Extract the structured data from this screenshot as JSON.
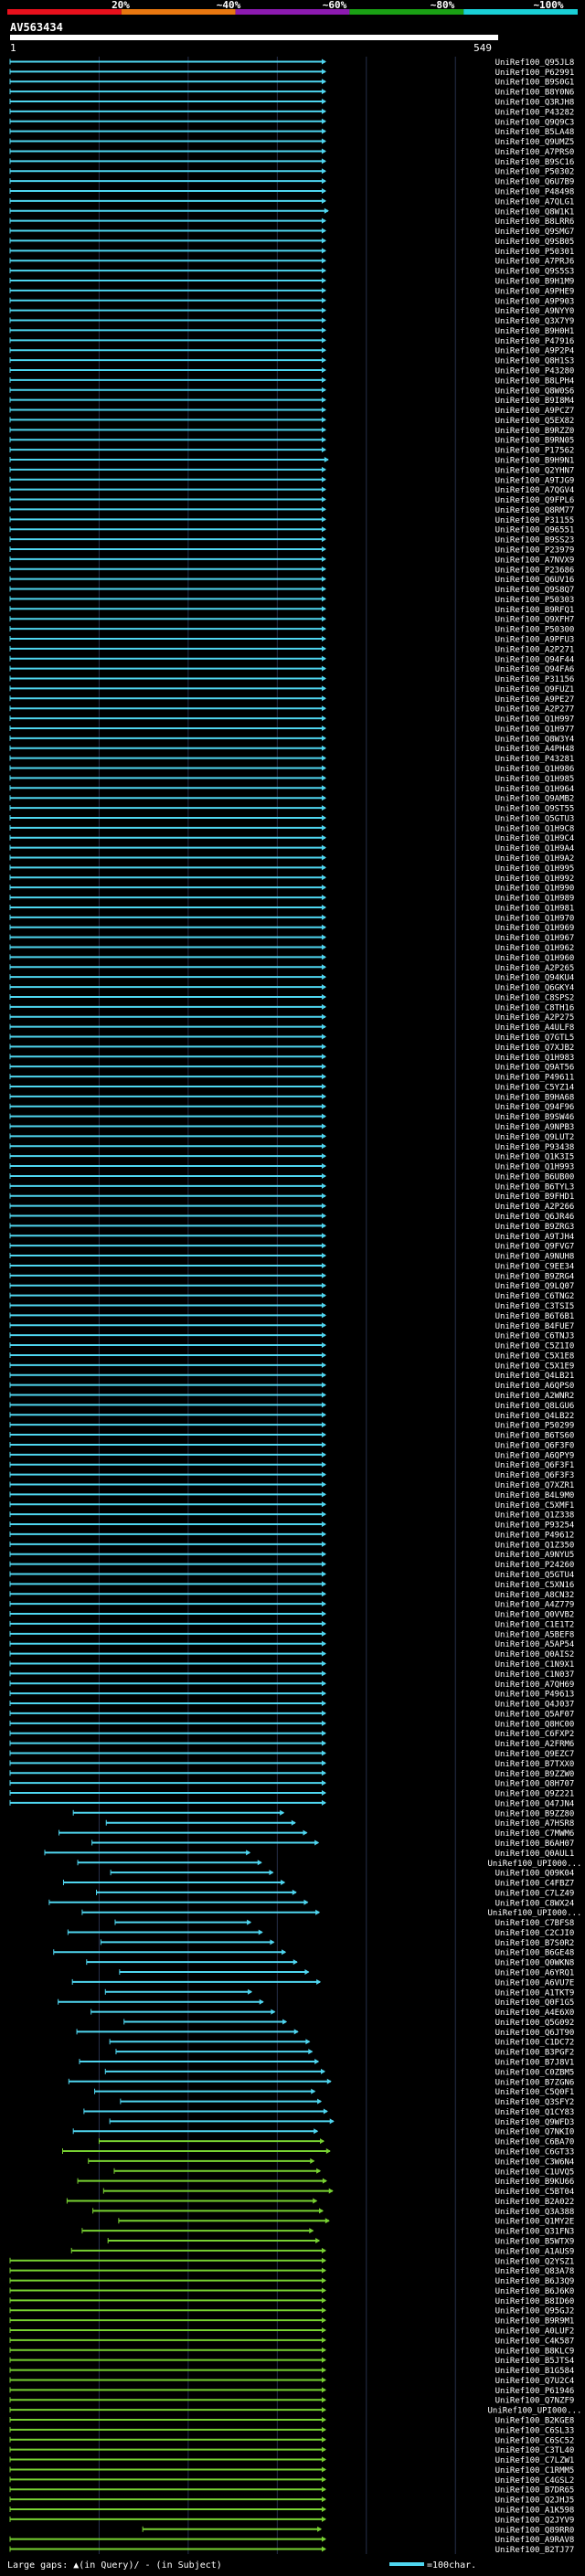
{
  "chart_data": {
    "type": "alignment-map",
    "query_name": "AV563434",
    "query_length": 549,
    "xlim": [
      1,
      549
    ],
    "scale": {
      "ticks": [
        {
          "label": "20%",
          "color": "#e8101c"
        },
        {
          "label": "~40%",
          "color": "#e87710"
        },
        {
          "label": "~60%",
          "color": "#8c1ab0"
        },
        {
          "label": "~80%",
          "color": "#1aa014"
        },
        {
          "label": "~100%",
          "color": "#1ad0d6"
        }
      ]
    },
    "axis": {
      "start_label": "1",
      "end_label": "549"
    },
    "footer": {
      "gaps_text": "Large gaps: ▲(in Query)/ - (in Subject)",
      "legend_text": "=100char."
    },
    "colors": {
      "cyan": "#4fd6f0",
      "green": "#78d232",
      "gap_query": "#ffff30",
      "gap_subject": "#ff0000",
      "grid": "#26304a",
      "bar_stripe_1": "#e8101c",
      "bar_stripe_2": "#e87710",
      "bar_stripe_3": "#8c1ab0",
      "bar_stripe_4": "#1aa014",
      "bar_stripe_5": "#1ad0d6"
    },
    "hits": [
      "UniRef100_Q95JL8",
      "UniRef100_P62991",
      "UniRef100_B9S0G1",
      "UniRef100_B8Y0N6",
      "UniRef100_Q3RJH8",
      "UniRef100_P43282",
      "UniRef100_Q9Q9C3",
      "UniRef100_B5LA48",
      "UniRef100_Q9UMZ5",
      "UniRef100_A7PRS0",
      "UniRef100_B9SC16",
      "UniRef100_P50302",
      "UniRef100_Q6U7B9",
      "UniRef100_P48498",
      "UniRef100_A7QLG1",
      "UniRef100_Q8W1K1",
      "UniRef100_B8LRR6",
      "UniRef100_Q9SMG7",
      "UniRef100_Q9SB05",
      "UniRef100_P50301",
      "UniRef100_A7PRJ6",
      "UniRef100_Q9S5S3",
      "UniRef100_B9H1M9",
      "UniRef100_A9PHE9",
      "UniRef100_A9P903",
      "UniRef100_A9NYY0",
      "UniRef100_Q3X7Y9",
      "UniRef100_B9H0H1",
      "UniRef100_P47916",
      "UniRef100_A9P2P4",
      "UniRef100_Q8H1S3",
      "UniRef100_P43280",
      "UniRef100_B8LPH4",
      "UniRef100_Q8W0S6",
      "UniRef100_B9I8M4",
      "UniRef100_A9PCZ7",
      "UniRef100_Q5EX82",
      "UniRef100_B9RZZ0",
      "UniRef100_B9RN05",
      "UniRef100_P17562",
      "UniRef100_B9H9N1",
      "UniRef100_Q2YHN7",
      "UniRef100_A9TJG9",
      "UniRef100_A7QGV4",
      "UniRef100_Q9FPL6",
      "UniRef100_Q8RM77",
      "UniRef100_P31155",
      "UniRef100_Q96551",
      "UniRef100_B9SS23",
      "UniRef100_P23979",
      "UniRef100_A7NVX9",
      "UniRef100_P23686",
      "UniRef100_Q6UV16",
      "UniRef100_Q9S8Q7",
      "UniRef100_P50303",
      "UniRef100_B9RFQ1",
      "UniRef100_Q9XFH7",
      "UniRef100_P50300",
      "UniRef100_A9PFU3",
      "UniRef100_A2P271",
      "UniRef100_Q94F44",
      "UniRef100_Q94FA6",
      "UniRef100_P31156",
      "UniRef100_Q9FUZ1",
      "UniRef100_A9PE27",
      "UniRef100_A2P277",
      "UniRef100_Q1H997",
      "UniRef100_Q1H977",
      "UniRef100_Q8W3Y4",
      "UniRef100_A4PH48",
      "UniRef100_P43281",
      "UniRef100_Q1H986",
      "UniRef100_Q1H985",
      "UniRef100_Q1H964",
      "UniRef100_Q9AMB2",
      "UniRef100_Q9ST55",
      "UniRef100_Q5GTU3",
      "UniRef100_Q1H9C8",
      "UniRef100_Q1H9C4",
      "UniRef100_Q1H9A4",
      "UniRef100_Q1H9A2",
      "UniRef100_Q1H995",
      "UniRef100_Q1H992",
      "UniRef100_Q1H990",
      "UniRef100_Q1H989",
      "UniRef100_Q1H981",
      "UniRef100_Q1H970",
      "UniRef100_Q1H969",
      "UniRef100_Q1H967",
      "UniRef100_Q1H962",
      "UniRef100_Q1H960",
      "UniRef100_A2P265",
      "UniRef100_Q94KU4",
      "UniRef100_Q6GKY4",
      "UniRef100_C8SPS2",
      "UniRef100_C8TH16",
      "UniRef100_A2P275",
      "UniRef100_A4ULF8",
      "UniRef100_Q7GTL5",
      "UniRef100_Q7XJB2",
      "UniRef100_Q1H983",
      "UniRef100_Q9AT56",
      "UniRef100_P49611",
      "UniRef100_C5YZ14",
      "UniRef100_B9HA68",
      "UniRef100_Q94F96",
      "UniRef100_B9SW46",
      "UniRef100_A9NPB3",
      "UniRef100_Q9LUT2",
      "UniRef100_P93438",
      "UniRef100_Q1K3I5",
      "UniRef100_Q1H993",
      "UniRef100_B6UB00",
      "UniRef100_B6TYL3",
      "UniRef100_B9FHD1",
      "UniRef100_A2P266",
      "UniRef100_Q6JR46",
      "UniRef100_B9ZRG3",
      "UniRef100_A9TJH4",
      "UniRef100_Q9FVG7",
      "UniRef100_A9NUH8",
      "UniRef100_C9EE34",
      "UniRef100_B9ZRG4",
      "UniRef100_Q9LQ07",
      "UniRef100_C6TNG2",
      "UniRef100_C3TSI5",
      "UniRef100_B6T6B1",
      "UniRef100_B4FUE7",
      "UniRef100_C6TNJ3",
      "UniRef100_C5Z1I0",
      "UniRef100_C5X1E8",
      "UniRef100_C5X1E9",
      "UniRef100_Q4LB21",
      "UniRef100_A6QPS0",
      "UniRef100_A2WNR2",
      "UniRef100_Q8LGU6",
      "UniRef100_Q4LB22",
      "UniRef100_P50299",
      "UniRef100_B6TS60",
      "UniRef100_Q6F3F0",
      "UniRef100_A6QPY9",
      "UniRef100_Q6F3F1",
      "UniRef100_Q6F3F3",
      "UniRef100_Q7XZR1",
      "UniRef100_B4L9M0",
      "UniRef100_C5XMF1",
      "UniRef100_Q1Z338",
      "UniRef100_P93254",
      "UniRef100_P49612",
      "UniRef100_Q1Z350",
      "UniRef100_A9NYU5",
      "UniRef100_P24260",
      "UniRef100_Q5GTU4",
      "UniRef100_C5XN16",
      "UniRef100_A8CN32",
      "UniRef100_A4Z779",
      "UniRef100_Q0VVB2",
      "UniRef100_C1E1T2",
      "UniRef100_A5BEF8",
      "UniRef100_A5AP54",
      "UniRef100_Q0AIS2",
      "UniRef100_C1N9X1",
      "UniRef100_C1N037",
      "UniRef100_A7QH69",
      "UniRef100_P49613",
      "UniRef100_Q4J037",
      "UniRef100_Q5AF07",
      "UniRef100_Q8HC00",
      "UniRef100_C6FXP2",
      "UniRef100_A2FRM6",
      "UniRef100_Q9EZC7",
      "UniRef100_B7TXX0",
      "UniRef100_B9ZZW0",
      "UniRef100_Q8H707",
      "UniRef100_Q9Z221",
      "UniRef100_Q47JN4",
      "UniRef100_B9ZZ80",
      "UniRef100_A7HSR8",
      "UniRef100_C7MWM6",
      "UniRef100_B6AH07",
      "UniRef100_Q0AUL1",
      "UniRef100_UPI000...",
      "UniRef100_Q09K04",
      "UniRef100_C4FBZ7",
      "UniRef100_C7LZ49",
      "UniRef100_C8WX24",
      "UniRef100_UPI000...",
      "UniRef100_C7BFS8",
      "UniRef100_C2CJI0",
      "UniRef100_B7S0R2",
      "UniRef100_B6GE48",
      "UniRef100_Q0WKN8",
      "UniRef100_A6YRQ1",
      "UniRef100_A6VU7E",
      "UniRef100_A1TKT9",
      "UniRef100_Q0F1G5",
      "UniRef100_A4E6X0",
      "UniRef100_Q5G092",
      "UniRef100_Q6JT90",
      "UniRef100_C1DC72",
      "UniRef100_B3PGF2",
      "UniRef100_B7J8V1",
      "UniRef100_C0ZBM5",
      "UniRef100_B7ZGN6",
      "UniRef100_C5Q0F1",
      "UniRef100_Q3SFY2",
      "UniRef100_Q1CY83",
      "UniRef100_Q9WFD3",
      "UniRef100_Q7NKI0",
      "UniRef100_C6BA70",
      "UniRef100_C6GT33",
      "UniRef100_C3W6N4",
      "UniRef100_C1UVQ5",
      "UniRef100_B9KU66",
      "UniRef100_C5BT04",
      "UniRef100_B2A022",
      "UniRef100_Q3A388",
      "UniRef100_Q1MY2E",
      "UniRef100_Q31FN3",
      "UniRef100_B5WTX9",
      "UniRef100_A1AUS9",
      "UniRef100_Q2YSZ1",
      "UniRef100_Q83A78",
      "UniRef100_B6J3Q9",
      "UniRef100_B6J6K0",
      "UniRef100_B8ID60",
      "UniRef100_Q95GJ2",
      "UniRef100_B9R9M1",
      "UniRef100_A0LUF2",
      "UniRef100_C4K587",
      "UniRef100_B8KLC9",
      "UniRef100_B5JTS4",
      "UniRef100_B1G584",
      "UniRef100_Q7U2C4",
      "UniRef100_P61946",
      "UniRef100_Q7NZF9",
      "UniRef100_UPI000...",
      "UniRef100_B2KGE8",
      "UniRef100_C6SL33",
      "UniRef100_C6SC52",
      "UniRef100_C3TL40",
      "UniRef100_C7LZW1",
      "UniRef100_C1RMM5",
      "UniRef100_C4GSL2",
      "UniRef100_B7DR65",
      "UniRef100_Q2JHJ5",
      "UniRef100_A1K598",
      "UniRef100_Q2JYV9",
      "UniRef100_Q89RR0",
      "UniRef100_A9RAV8",
      "UniRef100_B2TJ77"
    ]
  }
}
